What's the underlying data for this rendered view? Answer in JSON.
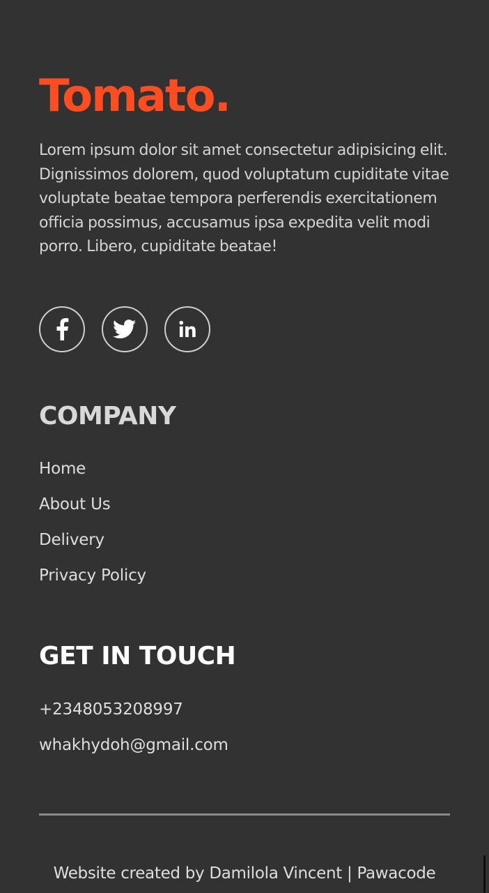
{
  "logo": {
    "text": "Tomato.",
    "color": "#ff4d22"
  },
  "description": "Lorem ipsum dolor sit amet consectetur adipisicing elit. Dignissimos dolorem, quod voluptatum cupiditate vitae voluptate beatae tempora perferendis exercitationem officia possimus, accusamus ipsa expedita velit modi porro. Libero, cupiditate beatae!",
  "social": [
    {
      "icon": "facebook-icon"
    },
    {
      "icon": "twitter-icon"
    },
    {
      "icon": "linkedin-icon"
    }
  ],
  "company": {
    "heading": "COMPANY",
    "links": [
      "Home",
      "About Us",
      "Delivery",
      "Privacy Policy"
    ]
  },
  "contact": {
    "heading": "GET IN TOUCH",
    "phone": "+2348053208997",
    "email": "whakhydoh@gmail.com"
  },
  "copyright": "Website created by Damilola Vincent | Pawacode",
  "colors": {
    "background": "#323232",
    "accent": "#ff4d22",
    "divider": "#8a8a8a"
  }
}
